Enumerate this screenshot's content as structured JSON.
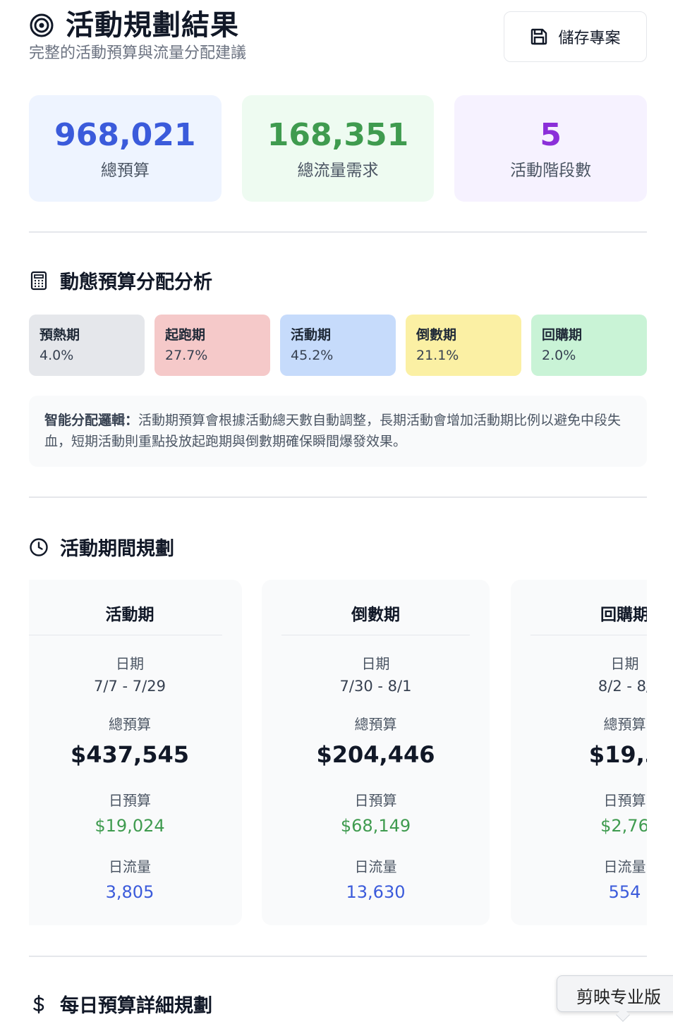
{
  "header": {
    "title": "活動規劃結果",
    "subtitle": "完整的活動預算與流量分配建議",
    "save_label": "儲存專案"
  },
  "stats": [
    {
      "value": "968,021",
      "label": "總預算",
      "color": "#3b5bdb"
    },
    {
      "value": "168,351",
      "label": "總流量需求",
      "color": "#3f9b4f"
    },
    {
      "value": "5",
      "label": "活動階段數",
      "color": "#8b2fd9"
    }
  ],
  "budget_section": {
    "title": "動態預算分配分析",
    "phases": [
      {
        "name": "預熱期",
        "pct": "4.0%",
        "color": "#e5e7eb"
      },
      {
        "name": "起跑期",
        "pct": "27.7%",
        "color": "#f5c9c9"
      },
      {
        "name": "活動期",
        "pct": "45.2%",
        "color": "#c6dbfb"
      },
      {
        "name": "倒數期",
        "pct": "21.1%",
        "color": "#fbf0a4"
      },
      {
        "name": "回購期",
        "pct": "2.0%",
        "color": "#c9f3d6"
      }
    ],
    "note_label": "智能分配邏輯：",
    "note_text": "活動期預算會根據活動總天數自動調整，長期活動會增加活動期比例以避免中段失血，短期活動則重點投放起跑期與倒數期確保瞬間爆發效果。"
  },
  "schedule_section": {
    "title": "活動期間規劃",
    "labels": {
      "date": "日期",
      "total_budget": "總預算",
      "daily_budget": "日預算",
      "daily_traffic": "日流量"
    },
    "cards": [
      {
        "name": "活動期",
        "date": "7/7 - 7/29",
        "total_budget": "$437,545",
        "daily_budget": "$19,024",
        "daily_traffic": "3,805"
      },
      {
        "name": "倒數期",
        "date": "7/30 - 8/1",
        "total_budget": "$204,446",
        "daily_budget": "$68,149",
        "daily_traffic": "13,630"
      },
      {
        "name": "回購期",
        "date": "8/2 - 8/",
        "total_budget": "$19,3",
        "daily_budget": "$2,76",
        "daily_traffic": "554"
      }
    ]
  },
  "daily_section": {
    "title": "每日預算詳細規劃"
  },
  "tooltip": {
    "text": "剪映专业版"
  }
}
